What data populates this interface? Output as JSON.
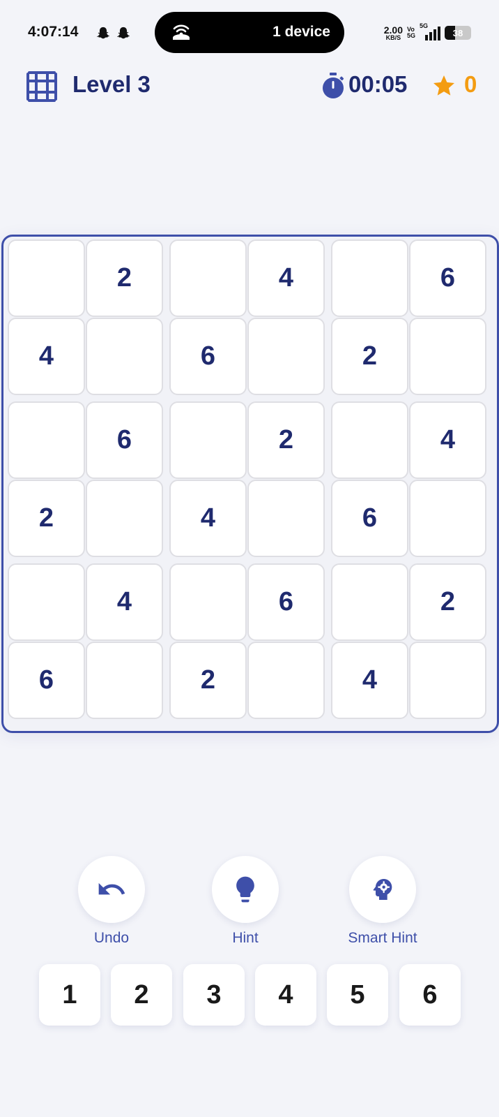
{
  "status_bar": {
    "time": "4:07:14",
    "island_text": "1 device",
    "net_speed_value": "2.00",
    "net_speed_unit": "KB/S",
    "vo_top": "Vo",
    "vo_bottom": "5G",
    "network": "5G",
    "battery": "38"
  },
  "header": {
    "level": "Level 3",
    "timer": "00:05",
    "score": "0",
    "accent_color": "#3e4fa9",
    "star_color": "#f39c12"
  },
  "board": {
    "rows": [
      [
        "",
        "2",
        "",
        "4",
        "",
        "6"
      ],
      [
        "4",
        "",
        "6",
        "",
        "2",
        ""
      ],
      [
        "",
        "6",
        "",
        "2",
        "",
        "4"
      ],
      [
        "2",
        "",
        "4",
        "",
        "6",
        ""
      ],
      [
        "",
        "4",
        "",
        "6",
        "",
        "2"
      ],
      [
        "6",
        "",
        "2",
        "",
        "4",
        ""
      ]
    ]
  },
  "actions": {
    "undo": "Undo",
    "hint": "Hint",
    "smart_hint": "Smart Hint"
  },
  "numpad": [
    "1",
    "2",
    "3",
    "4",
    "5",
    "6"
  ]
}
